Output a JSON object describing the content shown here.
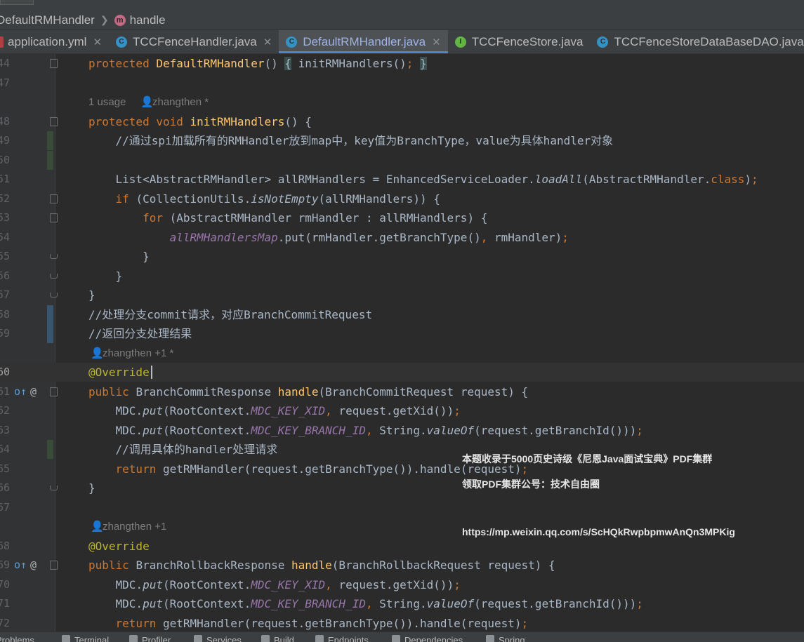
{
  "breadcrumb": {
    "class_name": "DefaultRMHandler",
    "method_icon": "m",
    "method_name": "handle"
  },
  "tabs": [
    {
      "label": "application.yml",
      "icon": "yaml-file-icon",
      "closable": true
    },
    {
      "label": "TCCFenceHandler.java",
      "icon": "class-icon",
      "closable": true
    },
    {
      "label": "DefaultRMHandler.java",
      "icon": "class-icon",
      "closable": true,
      "active": true
    },
    {
      "label": "TCCFenceStore.java",
      "icon": "interface-icon",
      "closable": false
    },
    {
      "label": "TCCFenceStoreDataBaseDAO.java",
      "icon": "class-icon",
      "closable": true
    }
  ],
  "tab_icon_letters": {
    "class": "C",
    "interface": "I"
  },
  "editor": {
    "lines": [
      {
        "num": "44",
        "code": "protected DefaultRMHandler() { initRMHandlers(); }"
      },
      {
        "num": "47",
        "code": ""
      },
      {
        "num": "48",
        "code": "protected void initRMHandlers() {"
      },
      {
        "num": "49",
        "code": "    //通过spi加载所有的RMHandler放到map中，key值为BranchType，value为具体handler对象"
      },
      {
        "num": "50",
        "code": ""
      },
      {
        "num": "51",
        "code": "    List<AbstractRMHandler> allRMHandlers = EnhancedServiceLoader.loadAll(AbstractRMHandler.class);"
      },
      {
        "num": "52",
        "code": "    if (CollectionUtils.isNotEmpty(allRMHandlers)) {"
      },
      {
        "num": "53",
        "code": "        for (AbstractRMHandler rmHandler : allRMHandlers) {"
      },
      {
        "num": "54",
        "code": "            allRMHandlersMap.put(rmHandler.getBranchType(), rmHandler);"
      },
      {
        "num": "55",
        "code": "        }"
      },
      {
        "num": "56",
        "code": "    }"
      },
      {
        "num": "57",
        "code": "}"
      },
      {
        "num": "58",
        "code": "//处理分支commit请求，对应BranchCommitRequest"
      },
      {
        "num": "59",
        "code": "//返回分支处理结果"
      },
      {
        "num": "60",
        "code": "@Override"
      },
      {
        "num": "61",
        "code": "public BranchCommitResponse handle(BranchCommitRequest request) {"
      },
      {
        "num": "62",
        "code": "    MDC.put(RootContext.MDC_KEY_XID, request.getXid());"
      },
      {
        "num": "63",
        "code": "    MDC.put(RootContext.MDC_KEY_BRANCH_ID, String.valueOf(request.getBranchId()));"
      },
      {
        "num": "64",
        "code": "    //调用具体的handler处理请求"
      },
      {
        "num": "65",
        "code": "    return getRMHandler(request.getBranchType()).handle(request);"
      },
      {
        "num": "66",
        "code": "}"
      },
      {
        "num": "67",
        "code": ""
      },
      {
        "num": "68",
        "code": "@Override"
      },
      {
        "num": "69",
        "code": "public BranchRollbackResponse handle(BranchRollbackRequest request) {"
      },
      {
        "num": "70",
        "code": "    MDC.put(RootContext.MDC_KEY_XID, request.getXid());"
      },
      {
        "num": "71",
        "code": "    MDC.put(RootContext.MDC_KEY_BRANCH_ID, String.valueOf(request.getBranchId()));"
      },
      {
        "num": "72",
        "code": "    return getRMHandler(request.getBranchType()).handle(request);"
      }
    ],
    "current_line": "60",
    "gutter_markers": {
      "override_icon": "o↑",
      "annotation_icon": "@"
    },
    "inlay_hints": {
      "usages": "1 usage",
      "author_hint_a": "zhangthen *",
      "author_hint_b": "zhangthen +1 *",
      "author_hint_c": "zhangthen +1"
    }
  },
  "watermark": {
    "line1": "本题收录于5000页史诗级《尼恩Java面试宝典》PDF集群",
    "line2": "领取PDF集群公号：技术自由圈",
    "url": "https://mp.weixin.qq.com/s/ScHQkRwpbpmwAnQn3MPKig"
  },
  "bottom_toolbar": [
    "Problems",
    "Terminal",
    "Profiler",
    "Services",
    "Build",
    "Endpoints",
    "Dependencies",
    "Spring"
  ],
  "colors": {
    "background": "#2b2b2b",
    "keyword": "#cc7832",
    "method": "#ffc66d",
    "annotation": "#bbb529",
    "field": "#9876aa",
    "active_tab_text": "#9fb2e6"
  }
}
